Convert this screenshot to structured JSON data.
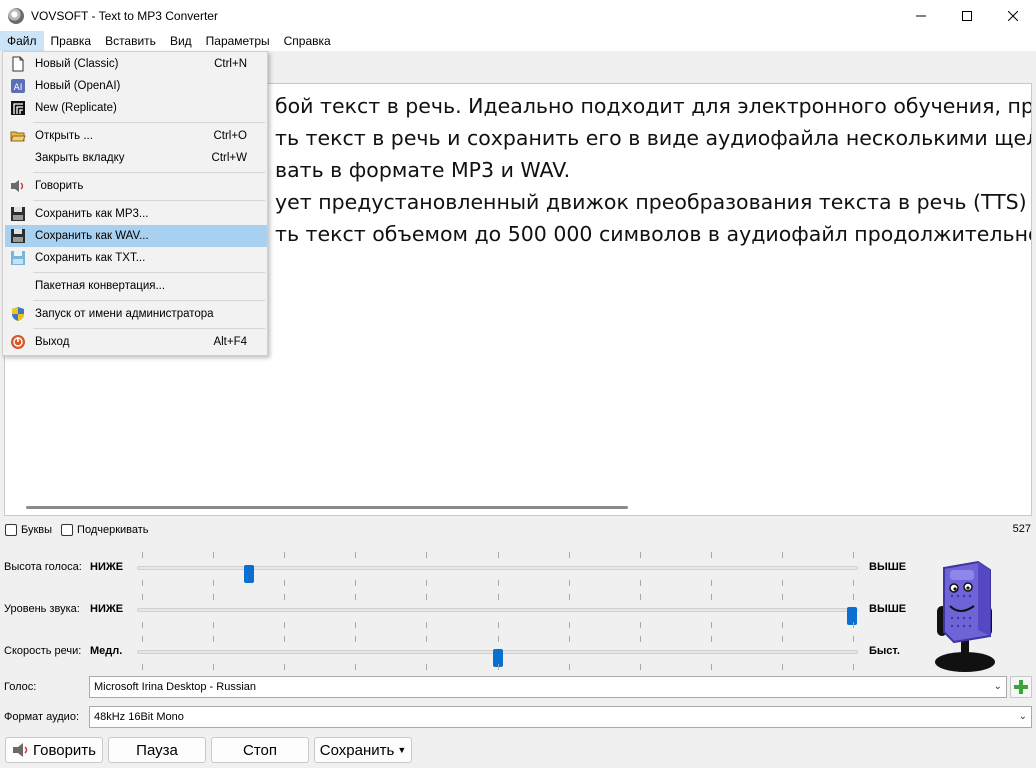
{
  "window": {
    "title": "VOVSOFT - Text to MP3 Converter"
  },
  "menubar": {
    "items": [
      "Файл",
      "Правка",
      "Вставить",
      "Вид",
      "Параметры",
      "Справка"
    ]
  },
  "file_menu": {
    "items": [
      {
        "label": "Новый (Classic)",
        "shortcut": "Ctrl+N",
        "icon": "new-document-icon"
      },
      {
        "label": "Новый (OpenAI)",
        "shortcut": "",
        "icon": "ai-icon"
      },
      {
        "label": "New (Replicate)",
        "shortcut": "",
        "icon": "replicate-icon"
      },
      {
        "label": "Открыть ...",
        "shortcut": "Ctrl+O",
        "icon": "open-folder-icon"
      },
      {
        "label": "Закрыть вкладку",
        "shortcut": "Ctrl+W",
        "icon": ""
      },
      {
        "label": "Говорить",
        "shortcut": "",
        "icon": "speaker-icon"
      },
      {
        "label": "Сохранить как MP3...",
        "shortcut": "",
        "icon": "floppy-icon"
      },
      {
        "label": "Сохранить как WAV...",
        "shortcut": "",
        "icon": "floppy-icon"
      },
      {
        "label": "Сохранить как TXT...",
        "shortcut": "",
        "icon": "txt-save-icon"
      },
      {
        "label": "Пакетная конвертация...",
        "shortcut": "",
        "icon": ""
      },
      {
        "label": "Запуск от имени администратора",
        "shortcut": "",
        "icon": "shield-icon"
      },
      {
        "label": "Выход",
        "shortcut": "Alt+F4",
        "icon": "power-icon"
      }
    ]
  },
  "editor": {
    "lines": [
      "бой текст в речь. Идеально подходит для электронного обучения, презе",
      "ть текст в речь и сохранить его в виде аудиофайла несколькими щелчк",
      "вать в формате MP3 и WAV.",
      "ует предустановленный движок преобразования текста в речь (TTS) Mic",
      "ть текст объемом до 500 000 символов в аудиофайл продолжительно"
    ]
  },
  "options": {
    "letters_label": "Буквы",
    "underline_label": "Подчеркивать",
    "char_count": "527"
  },
  "sliders": {
    "pitch": {
      "label": "Высота голоса:",
      "low": "НИЖЕ",
      "high": "ВЫШЕ",
      "level": 0.15
    },
    "volume": {
      "label": "Уровень звука:",
      "low": "НИЖЕ",
      "high": "ВЫШЕ",
      "level": 1.0
    },
    "rate": {
      "label": "Скорость речи:",
      "low": "Медл.",
      "high": "Быст.",
      "level": 0.5
    }
  },
  "voice": {
    "label": "Голос:",
    "value": "Microsoft Irina Desktop - Russian"
  },
  "audio_format": {
    "label": "Формат аудио:",
    "value": "48kHz 16Bit Mono"
  },
  "buttons": {
    "speak": "Говорить",
    "pause": "Пауза",
    "stop": "Стоп",
    "save": "Сохранить"
  },
  "colors": {
    "accent": "#0a6fd0",
    "menu_highlight": "#a8d0f0",
    "robot_body": "#6f63d8"
  }
}
